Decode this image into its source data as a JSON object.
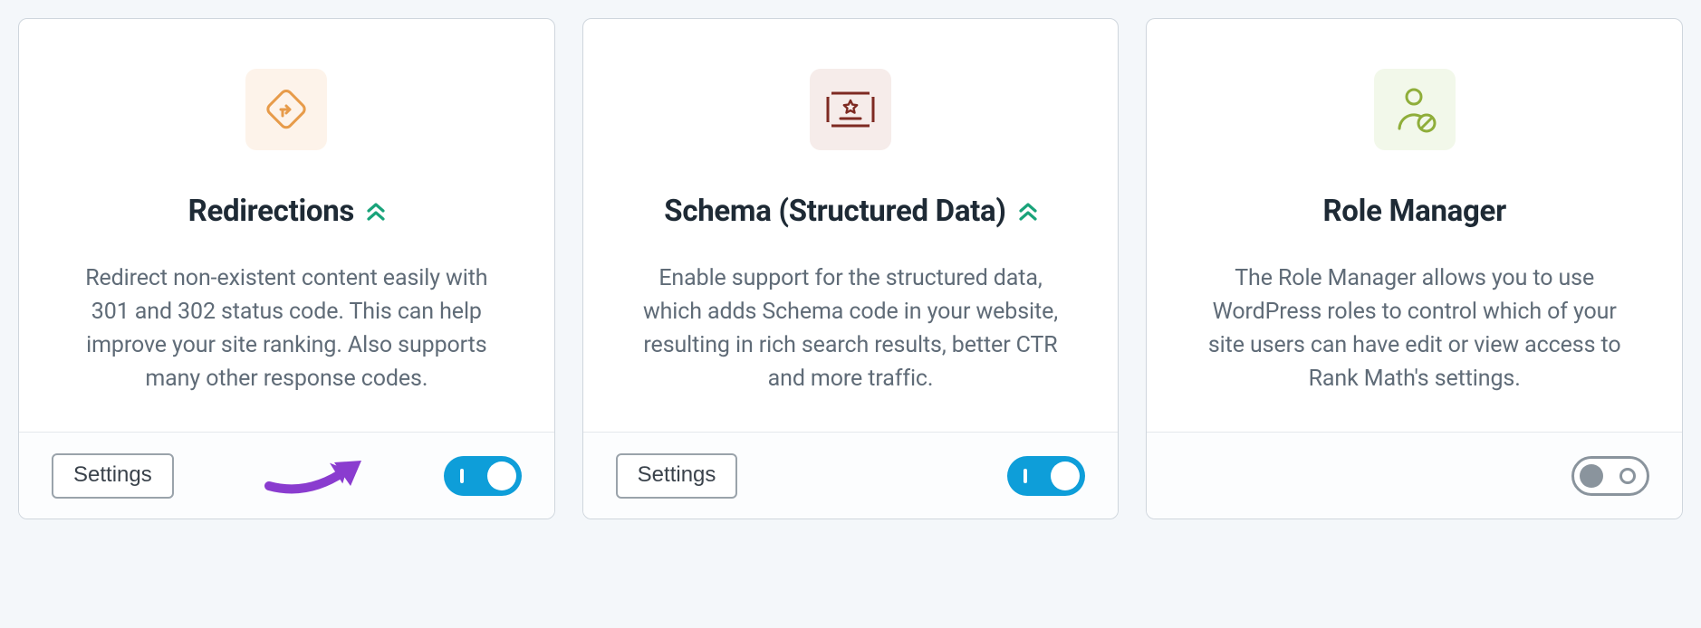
{
  "cards": [
    {
      "title": "Redirections",
      "description": "Redirect non-existent content easily with 301 and 302 status code. This can help improve your site ranking. Also supports many other response codes.",
      "settings_label": "Settings"
    },
    {
      "title": "Schema (Structured Data)",
      "description": "Enable support for the structured data, which adds Schema code in your website, resulting in rich search results, better CTR and more traffic.",
      "settings_label": "Settings"
    },
    {
      "title": "Role Manager",
      "description": "The Role Manager allows you to use WordPress roles to control which of your site users can have edit or view access to Rank Math's settings."
    }
  ]
}
